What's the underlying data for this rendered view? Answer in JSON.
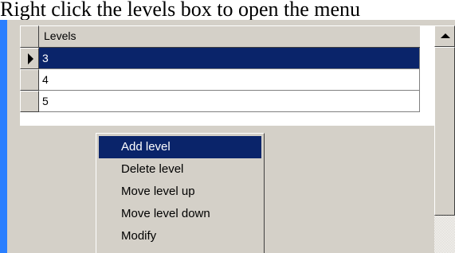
{
  "caption": "Right click the levels box to open the menu",
  "grid": {
    "column_header": "Levels",
    "rows": [
      {
        "value": "3",
        "selected": true,
        "current": true
      },
      {
        "value": "4",
        "selected": false,
        "current": false
      },
      {
        "value": "5",
        "selected": false,
        "current": false
      }
    ]
  },
  "context_menu": {
    "items": [
      {
        "label": "Add level",
        "highlighted": true
      },
      {
        "label": "Delete level",
        "highlighted": false
      },
      {
        "label": "Move level up",
        "highlighted": false
      },
      {
        "label": "Move level down",
        "highlighted": false
      },
      {
        "label": "Modify",
        "highlighted": false
      }
    ]
  },
  "colors": {
    "window_face": "#d4d0c8",
    "selection": "#0a246a",
    "selection_text": "#ffffff",
    "frame_edge": "#2a7fff"
  },
  "icons": {
    "row_indicator": "current-row-arrow-icon",
    "scroll_up": "scroll-up-arrow-icon"
  }
}
